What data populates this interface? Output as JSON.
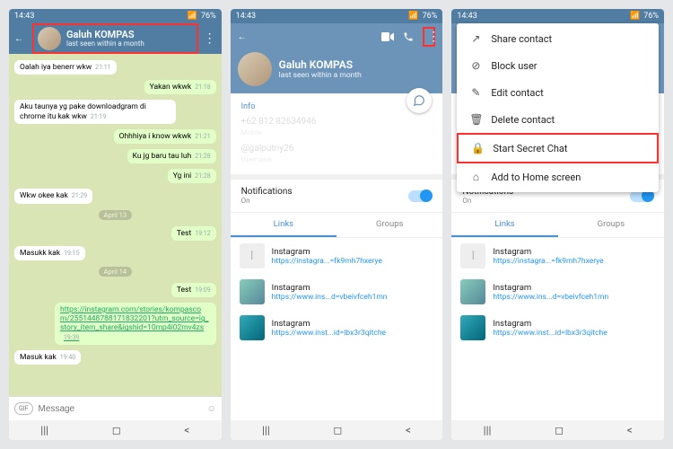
{
  "status": {
    "time": "14:43",
    "battery": "76%"
  },
  "contact": {
    "name": "Galuh KOMPAS",
    "lastseen": "last seen within a month"
  },
  "chat": {
    "messages": [
      {
        "t": "Oalah iya benerr wkw",
        "time": "21:11",
        "d": "in"
      },
      {
        "t": "Yakan wkwk",
        "time": "21:18",
        "d": "out"
      },
      {
        "t": "Aku taunya yg pake downloadgram di chrome itu kak wkw",
        "time": "21:19",
        "d": "in"
      },
      {
        "t": "Ohhhiya i know wkwk",
        "time": "21:21",
        "d": "out"
      },
      {
        "t": "Ku jg baru tau luh",
        "time": "21:28",
        "d": "out"
      },
      {
        "t": "Yg ini",
        "time": "21:28",
        "d": "out"
      },
      {
        "t": "Wkw okee kak",
        "time": "21:29",
        "d": "in"
      }
    ],
    "date1": "April 13",
    "tests": [
      {
        "t": "Test",
        "time": "19:12",
        "d": "out"
      },
      {
        "t": "Masukk kak",
        "time": "19:15",
        "d": "in"
      }
    ],
    "date2": "April 14",
    "tests2": [
      {
        "t": "Test",
        "time": "19:09",
        "d": "out"
      },
      {
        "t": "https://instagram.com/stories/kompascom/2551448788171832201?utm_source=ig_story_item_share&igshid=10mp4i02mv4zs",
        "time": "19:39",
        "d": "out",
        "link": true
      },
      {
        "t": "Masuk kak",
        "time": "19:40",
        "d": "in"
      }
    ],
    "placeholder": "Message"
  },
  "profile": {
    "info_label": "Info",
    "phone": "+62 812 82634946",
    "phone_sub": "Mobile",
    "username": "@galputriy26",
    "username_sub": "Username",
    "notifications": {
      "label": "Notifications",
      "value": "On"
    },
    "tabs": {
      "links": "Links",
      "groups": "Groups"
    },
    "links": [
      {
        "title": "Instagram",
        "url": "https://instagra...=fk9mh7hxerye"
      },
      {
        "title": "Instagram",
        "url": "https://www.ins...d=vbeivfceh1mn"
      },
      {
        "title": "Instagram",
        "url": "https://www.inst...id=lbx3r3qitche"
      }
    ]
  },
  "menu": {
    "share": "Share contact",
    "block": "Block user",
    "edit": "Edit contact",
    "delete": "Delete contact",
    "secret": "Start Secret Chat",
    "home": "Add to Home screen"
  },
  "gif": "GIF"
}
